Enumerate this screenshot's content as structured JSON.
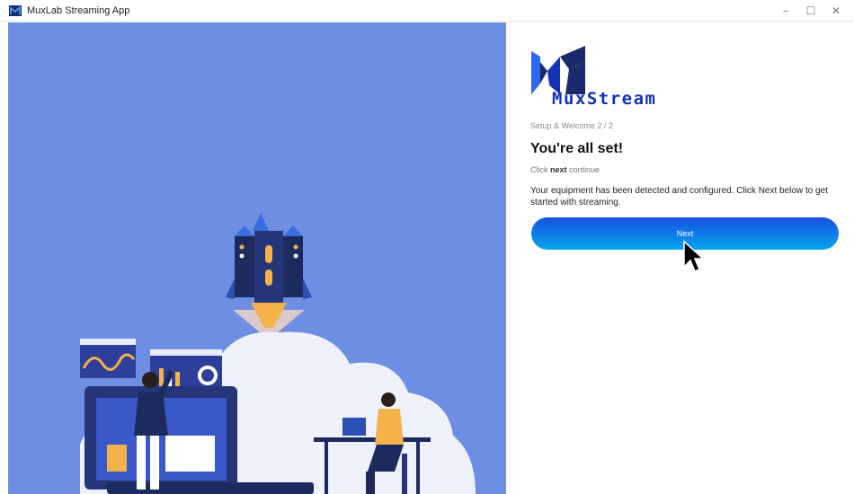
{
  "window": {
    "title": "MuxLab Streaming App",
    "controls": {
      "minimize": "–",
      "maximize": "☐",
      "close": "✕"
    }
  },
  "brand": {
    "logo_text": "MuxStream",
    "logo_primary_color": "#1c2a6b",
    "logo_accent_color": "#1432b8"
  },
  "setup": {
    "step_label": "Setup & Welcome 2 / 2",
    "title": "You're all set!",
    "hint_prefix": "Click ",
    "hint_keyword": "next",
    "hint_suffix": " continue",
    "description": "Your equipment has been detected and configured. Click Next below to get started with streaming.",
    "next_label": "Next"
  },
  "colors": {
    "illustration_bg": "#6d8ee3",
    "button_gradient_start": "#1a4fe0",
    "button_gradient_end": "#07a6ee"
  },
  "icons": {
    "app": "muxlab-app-icon",
    "cursor": "mouse-pointer-icon"
  }
}
